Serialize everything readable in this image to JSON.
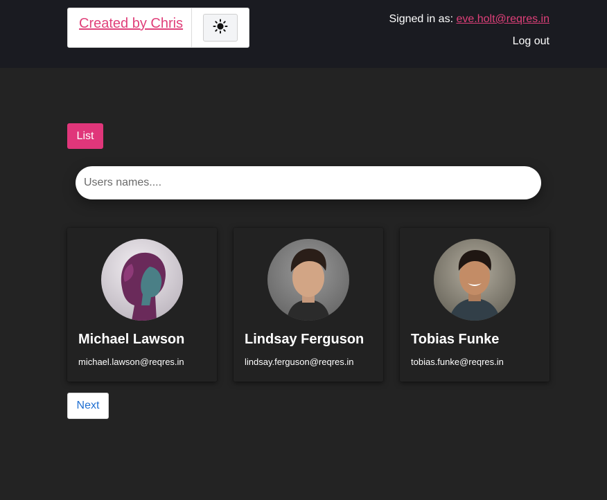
{
  "header": {
    "brand_link": "Created by Chris",
    "theme_toggle_icon": "sun-icon",
    "signed_in_label": "Signed in as:",
    "signed_in_email": "eve.holt@reqres.in",
    "logout_label": "Log out"
  },
  "main": {
    "list_button": "List",
    "search_placeholder": "Users names....",
    "users": [
      {
        "name": "Michael Lawson",
        "email": "michael.lawson@reqres.in"
      },
      {
        "name": "Lindsay Ferguson",
        "email": "lindsay.ferguson@reqres.in"
      },
      {
        "name": "Tobias Funke",
        "email": "tobias.funke@reqres.in"
      }
    ],
    "next_button": "Next"
  },
  "colors": {
    "accent": "#e0367a",
    "link": "#e0407a",
    "page_bg": "#232323",
    "header_bg": "#1a1b21",
    "next_text": "#1f6fd1"
  }
}
